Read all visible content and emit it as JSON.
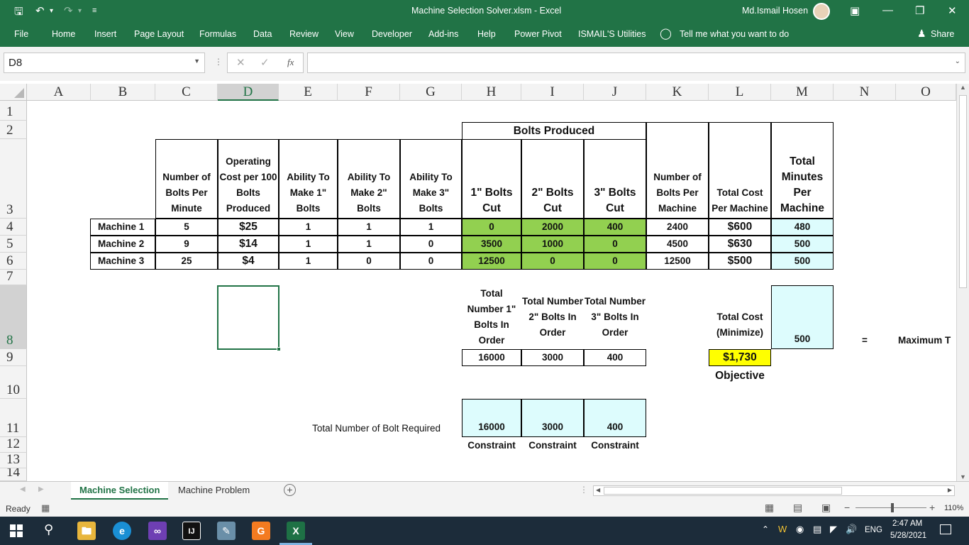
{
  "app": {
    "title": "Machine Selection Solver.xlsm  -  Excel",
    "user": "Md.Ismail Hosen",
    "share": "Share"
  },
  "ribbon": {
    "tabs": [
      "File",
      "Home",
      "Insert",
      "Page Layout",
      "Formulas",
      "Data",
      "Review",
      "View",
      "Developer",
      "Add-ins",
      "Help",
      "Power Pivot",
      "ISMAIL'S Utilities"
    ],
    "tell_me": "Tell me what you want to do"
  },
  "formula_bar": {
    "name_box": "D8",
    "fx": "fx",
    "value": ""
  },
  "columns": [
    "A",
    "B",
    "C",
    "D",
    "E",
    "F",
    "G",
    "H",
    "I",
    "J",
    "K",
    "L",
    "M",
    "N",
    "O"
  ],
  "rows": [
    "1",
    "2",
    "3",
    "4",
    "5",
    "6",
    "7",
    "8",
    "9",
    "10",
    "11",
    "12",
    "13",
    "14"
  ],
  "sheet": {
    "bolts_produced": "Bolts Produced",
    "headers": {
      "c": "Number of Bolts Per Minute",
      "d": "Operating Cost per 100 Bolts Produced",
      "e": "Ability To Make 1\" Bolts",
      "f": "Ability To Make 2\" Bolts",
      "g": "Ability To Make 3\" Bolts",
      "h": "1\" Bolts Cut",
      "i": "2\" Bolts Cut",
      "j": "3\" Bolts Cut",
      "k": "Number of Bolts Per Machine",
      "l": "Total Cost Per Machine",
      "m": "Total Minutes Per Machine"
    },
    "machines": [
      {
        "name": "Machine 1",
        "rate": "5",
        "cost": "$25",
        "a1": "1",
        "a2": "1",
        "a3": "1",
        "cut1": "0",
        "cut2": "2000",
        "cut3": "400",
        "bolts": "2400",
        "total_cost": "$600",
        "minutes": "480"
      },
      {
        "name": "Machine 2",
        "rate": "9",
        "cost": "$14",
        "a1": "1",
        "a2": "1",
        "a3": "0",
        "cut1": "3500",
        "cut2": "1000",
        "cut3": "0",
        "bolts": "4500",
        "total_cost": "$630",
        "minutes": "500"
      },
      {
        "name": "Machine 3",
        "rate": "25",
        "cost": "$4",
        "a1": "1",
        "a2": "0",
        "a3": "0",
        "cut1": "12500",
        "cut2": "0",
        "cut3": "0",
        "bolts": "12500",
        "total_cost": "$500",
        "minutes": "500"
      }
    ],
    "order_headers": {
      "h": "Total Number 1\" Bolts In Order",
      "i": "Total Number 2\" Bolts In Order",
      "j": "Total Number 3\" Bolts In Order"
    },
    "order_totals": {
      "h": "16000",
      "i": "3000",
      "j": "400"
    },
    "total_cost_label": "Total Cost (Minimize)",
    "total_cost_value": "$1,730",
    "objective": "Objective",
    "max_minutes": "500",
    "equals": "=",
    "max_label": "Maximum T",
    "required_label": "Total Number of Bolt Required",
    "required": {
      "h": "16000",
      "i": "3000",
      "j": "400"
    },
    "constraint": "Constraint"
  },
  "sheet_tabs": [
    "Machine Selection",
    "Machine Problem"
  ],
  "status": {
    "ready": "Ready",
    "zoom": "110%"
  },
  "taskbar": {
    "lang": "ENG",
    "time": "2:47 AM",
    "date": "5/28/2021"
  }
}
